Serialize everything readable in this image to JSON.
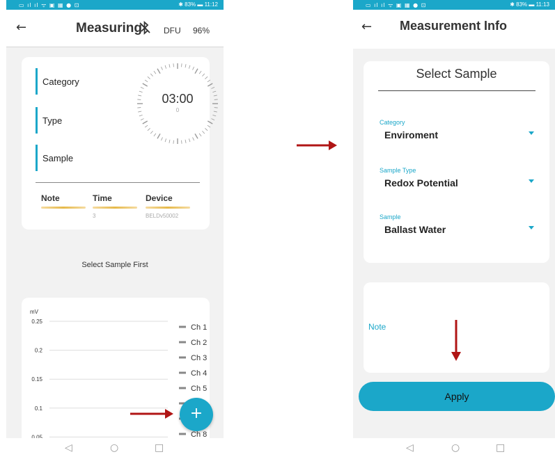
{
  "left_screen": {
    "status_left": "▭ ıl ıl ᯤ ▣ ▦ ● ⊡",
    "status_right": "✱ 83% ▬ 11:12",
    "back_icon": "←",
    "title": "Measuring",
    "bluetooth_icon": "bluetooth-off-icon",
    "bt_glyph": "✗",
    "dfu": "DFU",
    "battery": "96%",
    "fields": {
      "category": "Category",
      "type": "Type",
      "sample": "Sample"
    },
    "timer": {
      "time": "03:00",
      "sub": "0"
    },
    "meta": {
      "note_label": "Note",
      "time_label": "Time",
      "time_value": "3",
      "device_label": "Device",
      "device_value": "BELDv50002"
    },
    "select_first": "Select Sample First",
    "fab_label": "+"
  },
  "chart_data": {
    "type": "line",
    "ylabel": "mV",
    "y_ticks": [
      "0.25",
      "0.2",
      "0.15",
      "0.1",
      "0.05"
    ],
    "y_values": [
      0.25,
      0.2,
      0.15,
      0.1,
      0.05
    ],
    "legend": [
      "Ch 1",
      "Ch 2",
      "Ch 3",
      "Ch 4",
      "Ch 5",
      "Ch 6",
      "Ch 7",
      "Ch 8"
    ],
    "series": [],
    "grid": true,
    "legend_placement": "right"
  },
  "right_screen": {
    "status_left": "▭ ıl ıl ᯤ ▣ ▦ ● ⊡",
    "status_right": "✱ 83% ▬ 11:13",
    "back_icon": "←",
    "title": "Measurement Info",
    "card_title": "Select Sample",
    "dropdowns": [
      {
        "label": "Category",
        "value": "Enviroment"
      },
      {
        "label": "Sample Type",
        "value": "Redox Potential"
      },
      {
        "label": "Sample",
        "value": "Ballast Water"
      }
    ],
    "note_label": "Note",
    "apply_label": "Apply"
  },
  "nav": {
    "back": "◁",
    "home": "○",
    "recent": "□"
  },
  "colors": {
    "accent": "#1ba7c9",
    "arrow": "#b01515",
    "gold": "#e6b94a"
  }
}
